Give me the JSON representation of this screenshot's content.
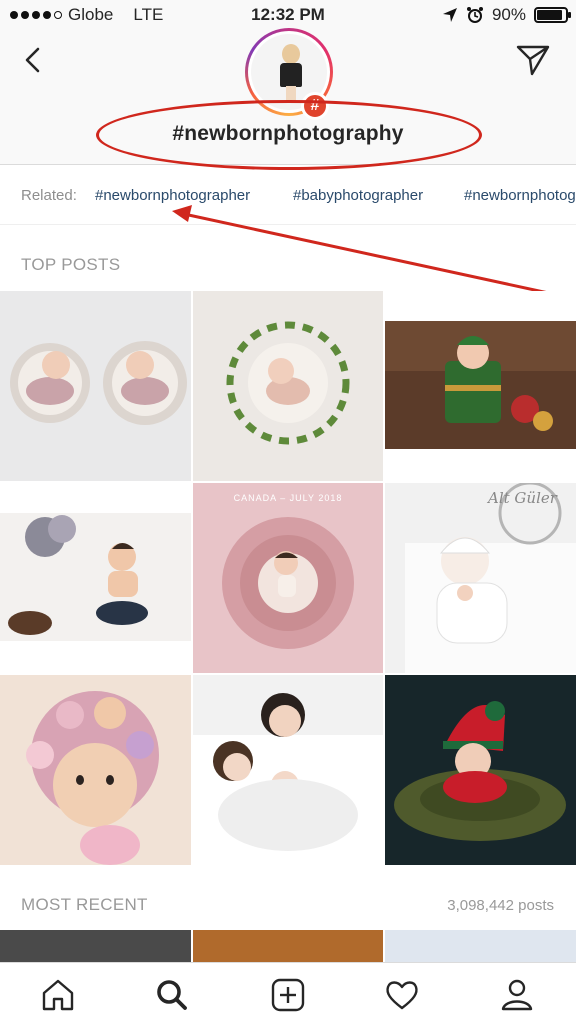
{
  "status_bar": {
    "carrier": "Globe",
    "network": "LTE",
    "time": "12:32 PM",
    "battery": "90%",
    "battery_level": 0.9
  },
  "header": {
    "hashtag": "#newbornphotography",
    "badge_symbol": "#"
  },
  "related": {
    "label": "Related:",
    "tags": [
      "#newbornphotographer",
      "#babyphotographer",
      "#newbornphotographer"
    ]
  },
  "top_posts": {
    "title": "TOP POSTS"
  },
  "post_overlays": {
    "canada_caption": "CANADA – JULY 2018",
    "alt_guler": "Alt Güler"
  },
  "most_recent": {
    "title": "MOST RECENT",
    "count": "3,098,442 posts"
  },
  "bottom_nav": [
    "home-icon",
    "search-icon",
    "add-post-icon",
    "heart-icon",
    "profile-icon"
  ],
  "colors": {
    "annotation_red": "#d0271d",
    "link": "#2a4a6b",
    "badge": "#e0442d"
  }
}
